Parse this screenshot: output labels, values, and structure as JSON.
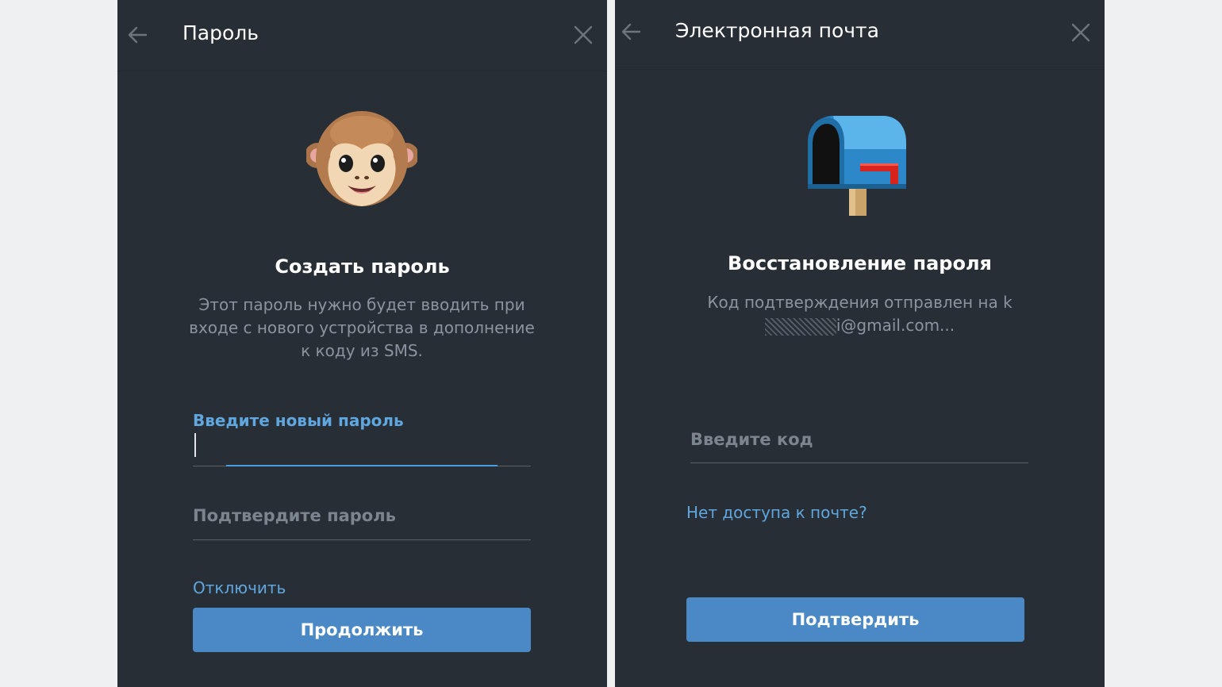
{
  "left": {
    "header_title": "Пароль",
    "heading": "Создать пароль",
    "description": "Этот пароль нужно будет вводить при входе с нового устройства в дополнение к коду из SMS.",
    "new_password_label": "Введите новый пароль",
    "new_password_value": "",
    "confirm_placeholder": "Подтвердите пароль",
    "disable_link": "Отключить",
    "continue_button": "Продолжить",
    "illustration_icon": "monkey-face-icon"
  },
  "right": {
    "header_title": "Электронная почта",
    "heading": "Восстановление пароля",
    "description": "Код подтверждения отправлен на k",
    "email_tail": "i@gmail.com...",
    "code_placeholder": "Введите код",
    "no_access_link": "Нет доступа к почте?",
    "confirm_button": "Подтвердить",
    "illustration_icon": "mailbox-icon"
  },
  "colors": {
    "panel_bg": "#282e36",
    "page_bg": "#eff0f2",
    "accent": "#5fa7de",
    "button_bg": "#4a89c5",
    "muted_text": "#8b949e"
  }
}
